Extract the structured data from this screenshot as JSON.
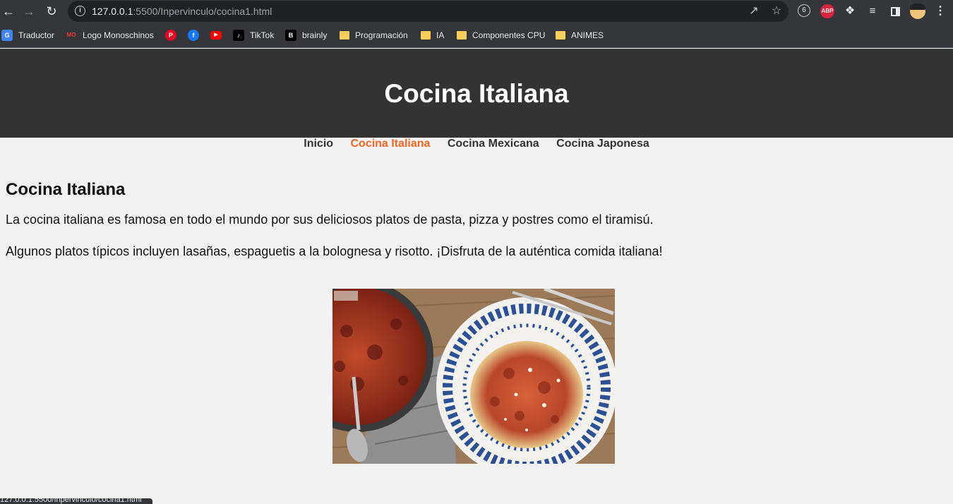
{
  "browser": {
    "url_host": "127.0.0.1",
    "url_rest": ":5500/Inpervinculo/cocina1.html",
    "bookmarks": [
      {
        "label": "Traductor",
        "icon": "google-translate-icon"
      },
      {
        "label": "Logo Monoschinos",
        "icon": "monoschinos-icon"
      },
      {
        "label": "",
        "icon": "pinterest-icon"
      },
      {
        "label": "",
        "icon": "facebook-icon"
      },
      {
        "label": "",
        "icon": "youtube-icon"
      },
      {
        "label": "TikTok",
        "icon": "tiktok-icon"
      },
      {
        "label": "brainly",
        "icon": "brainly-icon"
      },
      {
        "label": "Programación",
        "icon": "folder-icon"
      },
      {
        "label": "IA",
        "icon": "folder-icon"
      },
      {
        "label": "Componentes CPU",
        "icon": "folder-icon"
      },
      {
        "label": "ANIMES",
        "icon": "folder-icon"
      }
    ],
    "status_text": "127.0.0.1:5500/Inpervinculo/cocina1.html"
  },
  "page": {
    "header_title": "Cocina Italiana",
    "nav": [
      "Inicio",
      "Cocina Italiana",
      "Cocina Mexicana",
      "Cocina Japonesa"
    ],
    "active_nav_index": 1,
    "section_title": "Cocina Italiana",
    "paragraphs": [
      "La cocina italiana es famosa en todo el mundo por sus deliciosos platos de pasta, pizza y postres como el tiramisú.",
      "Algunos platos típicos incluyen lasañas, espaguetis a la bolognesa y risotto. ¡Disfruta de la auténtica comida italiana!"
    ]
  },
  "colors": {
    "header_bg": "#333333",
    "page_bg": "#f2f2f2",
    "nav_active": "#f26522"
  }
}
